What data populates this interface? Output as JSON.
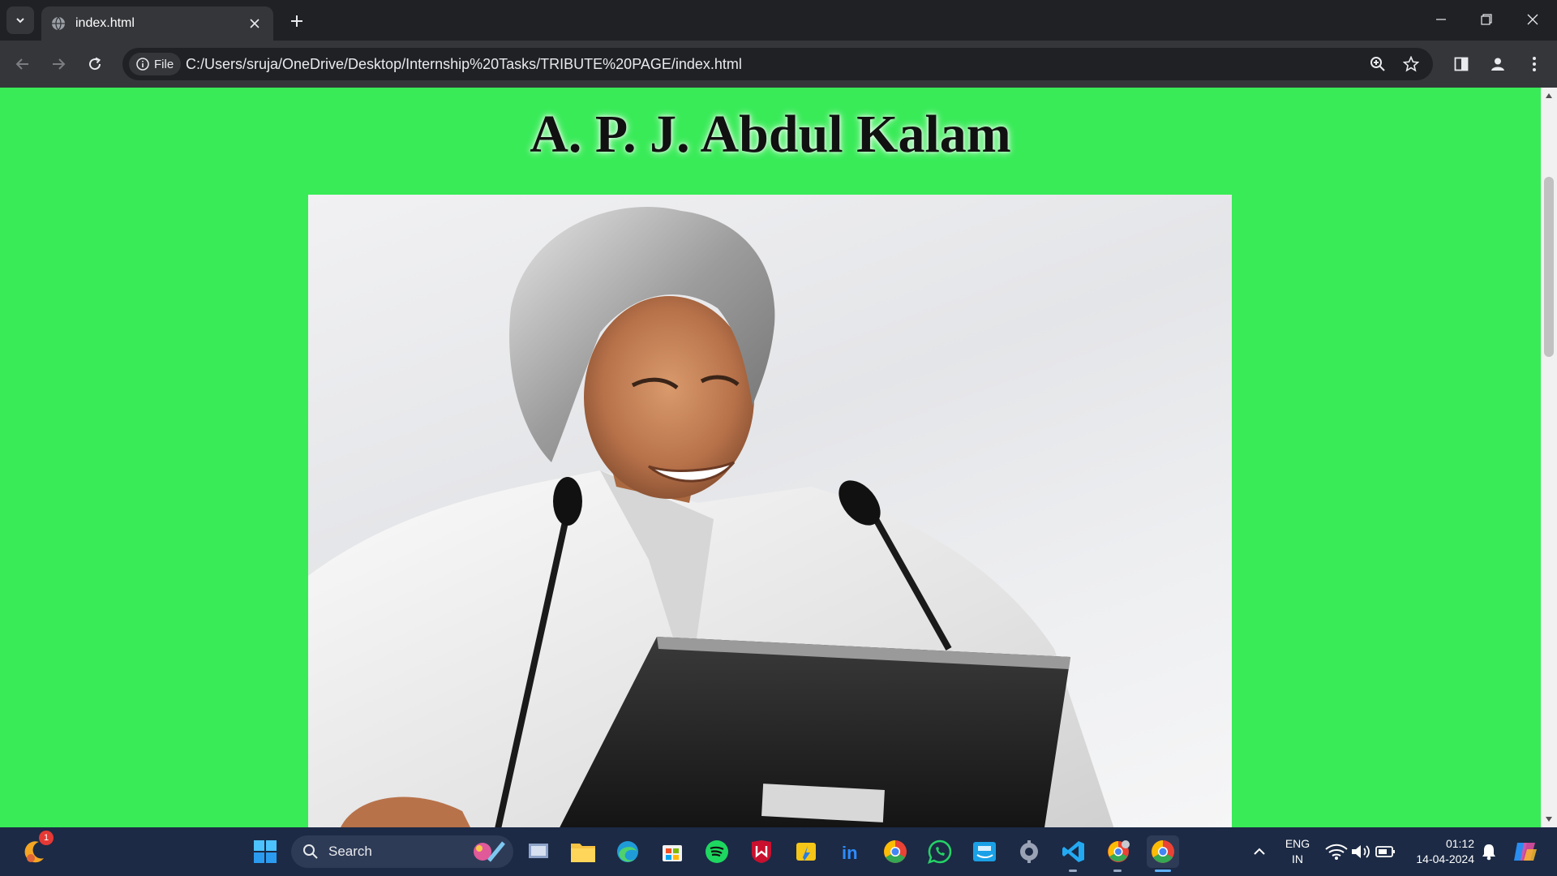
{
  "browser": {
    "tab_title": "index.html",
    "site_chip": "File",
    "url": "C:/Users/sruja/OneDrive/Desktop/Internship%20Tasks/TRIBUTE%20PAGE/index.html"
  },
  "page": {
    "heading": "A. P. J. Abdul Kalam",
    "background_color": "#38eb57",
    "image_subject": "portrait-photo"
  },
  "taskbar": {
    "search_label": "Search",
    "language_line1": "ENG",
    "language_line2": "IN",
    "time": "01:12",
    "date": "14-04-2024",
    "notification_count": "1",
    "apps": [
      "file-explorer",
      "edge",
      "microsoft-store",
      "spotify",
      "mcafee",
      "files",
      "linkedin",
      "chrome",
      "whatsapp",
      "prime-video",
      "settings",
      "vscode",
      "chrome-profile",
      "chrome"
    ]
  }
}
